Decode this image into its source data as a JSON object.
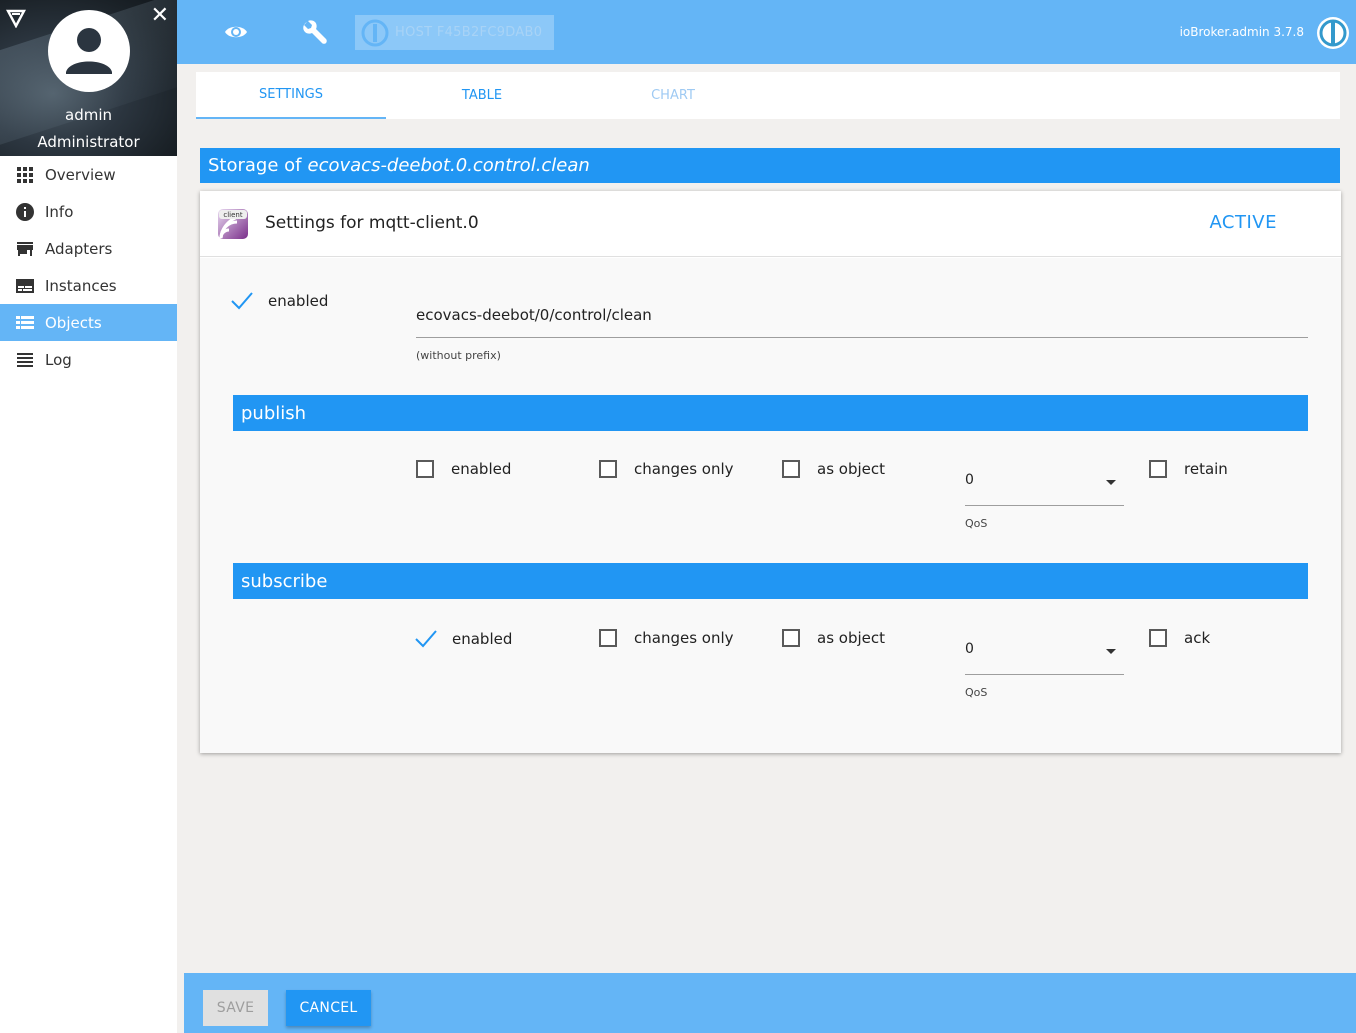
{
  "sidebar": {
    "user_name": "admin",
    "user_role": "Administrator",
    "items": [
      {
        "label": "Overview",
        "icon": "apps-grid-icon"
      },
      {
        "label": "Info",
        "icon": "info-icon"
      },
      {
        "label": "Adapters",
        "icon": "store-icon"
      },
      {
        "label": "Instances",
        "icon": "instances-icon"
      },
      {
        "label": "Objects",
        "icon": "list-icon",
        "active": true
      },
      {
        "label": "Log",
        "icon": "menu-lines-icon"
      }
    ]
  },
  "topbar": {
    "host_label": "HOST F45B2FC9DAB0",
    "version": "ioBroker.admin 3.7.8"
  },
  "tabs": [
    {
      "label": "SETTINGS",
      "state": "active"
    },
    {
      "label": "TABLE",
      "state": "normal"
    },
    {
      "label": "CHART",
      "state": "disabled"
    }
  ],
  "storage": {
    "prefix": "Storage of",
    "object_id": "ecovacs-deebot.0.control.clean"
  },
  "card": {
    "title": "Settings for mqtt-client.0",
    "status": "ACTIVE",
    "icon_text": "client",
    "enabled_label": "enabled",
    "enabled_checked": true,
    "topic_value": "ecovacs-deebot/0/control/clean",
    "topic_hint": "(without prefix)"
  },
  "publish": {
    "title": "publish",
    "enabled": {
      "label": "enabled",
      "checked": false
    },
    "changes_only": {
      "label": "changes only",
      "checked": false
    },
    "as_object": {
      "label": "as object",
      "checked": false
    },
    "qos_value": "0",
    "qos_label": "QoS",
    "retain": {
      "label": "retain",
      "checked": false
    }
  },
  "subscribe": {
    "title": "subscribe",
    "enabled": {
      "label": "enabled",
      "checked": true
    },
    "changes_only": {
      "label": "changes only",
      "checked": false
    },
    "as_object": {
      "label": "as object",
      "checked": false
    },
    "qos_value": "0",
    "qos_label": "QoS",
    "ack": {
      "label": "ack",
      "checked": false
    }
  },
  "footer": {
    "save_label": "SAVE",
    "cancel_label": "CANCEL"
  },
  "colors": {
    "primary": "#2196f3",
    "primary_light": "#64b5f6",
    "background": "#f2f0ee"
  }
}
